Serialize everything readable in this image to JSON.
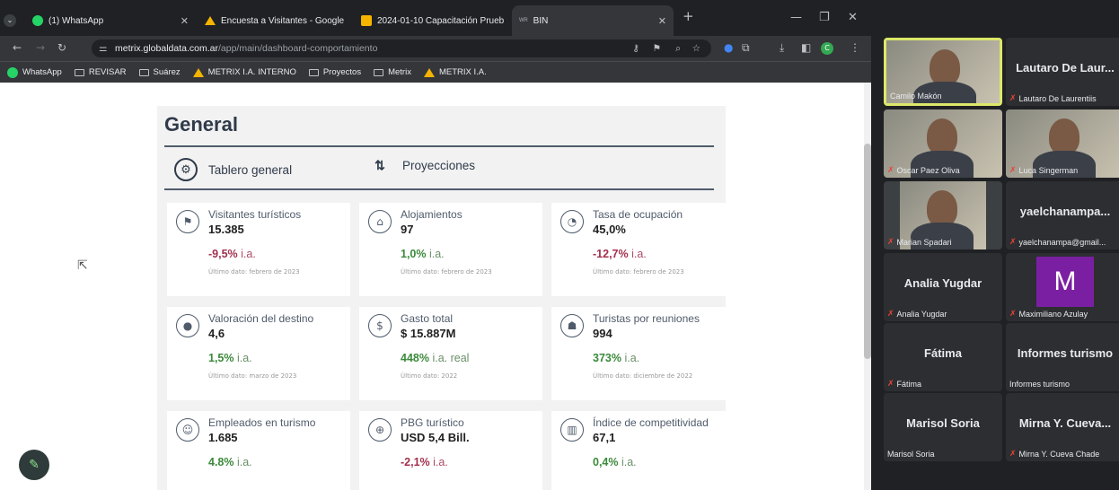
{
  "browser": {
    "tabs": [
      {
        "label": "(1) WhatsApp",
        "favicon": "whatsapp-icon",
        "color": "#25d366"
      },
      {
        "label": "Encuesta a Visitantes - Google",
        "favicon": "drive-icon",
        "color": "#f4b400"
      },
      {
        "label": "2024-01-10 Capacitación Prueb",
        "favicon": "slides-icon",
        "color": "#f4b400"
      },
      {
        "label": "BIN",
        "favicon": "bin-icon",
        "color": "#9aa0a6"
      }
    ],
    "new_tab": "+",
    "address": {
      "domain": "metrix.globaldata.com.ar",
      "path": "/app/main/dashboard-comportamiento"
    },
    "bookmarks": [
      {
        "label": "WhatsApp",
        "icon": "whatsapp-icon"
      },
      {
        "label": "REVISAR",
        "icon": "folder-icon"
      },
      {
        "label": "Suárez",
        "icon": "folder-icon"
      },
      {
        "label": "METRIX I.A. INTERNO",
        "icon": "metrix-icon"
      },
      {
        "label": "Proyectos",
        "icon": "folder-icon"
      },
      {
        "label": "Metrix",
        "icon": "folder-icon"
      },
      {
        "label": "METRIX I.A.",
        "icon": "metrix-icon"
      }
    ],
    "profile_initial": "C"
  },
  "dashboard": {
    "title": "General",
    "tabs": [
      {
        "label": "Tablero general",
        "icon": "gauge-icon"
      },
      {
        "label": "Proyecciones",
        "icon": "sort-icon"
      }
    ],
    "cards": [
      {
        "title": "Visitantes turísticos",
        "value": "15.385",
        "change": "-9,5%",
        "unit": "i.a.",
        "trend": "neg",
        "note": "Último dato: febrero de 2023",
        "icon": "flag-icon"
      },
      {
        "title": "Alojamientos",
        "value": "97",
        "change": "1,0%",
        "unit": "i.a.",
        "trend": "pos",
        "note": "Último dato: febrero de 2023",
        "icon": "home-icon"
      },
      {
        "title": "Tasa de ocupación",
        "value": "45,0%",
        "change": "-12,7%",
        "unit": "i.a.",
        "trend": "neg",
        "note": "Último dato: febrero de 2023",
        "icon": "pie-icon"
      },
      {
        "title": "Valoración del destino",
        "value": "4,6",
        "change": "1,5%",
        "unit": "i.a.",
        "trend": "pos",
        "note": "Último dato: marzo de 2023",
        "icon": "location-icon"
      },
      {
        "title": "Gasto total",
        "value": "$ 15.887M",
        "change": "448%",
        "unit": "i.a. real",
        "trend": "pos",
        "note": "Último dato: 2022",
        "icon": "dollar-icon"
      },
      {
        "title": "Turistas por reuniones",
        "value": "994",
        "change": "373%",
        "unit": "i.a.",
        "trend": "pos",
        "note": "Último dato: diciembre de 2022",
        "icon": "meeting-icon"
      },
      {
        "title": "Empleados en turismo",
        "value": "1.685",
        "change": "4.8%",
        "unit": "i.a.",
        "trend": "pos",
        "note": "",
        "icon": "employee-icon"
      },
      {
        "title": "PBG turístico",
        "value": "USD 5,4 Bill.",
        "change": "-2,1%",
        "unit": "i.a.",
        "trend": "neg",
        "note": "",
        "icon": "globe-icon"
      },
      {
        "title": "Índice de competitividad",
        "value": "67,1",
        "change": "0,4%",
        "unit": "i.a.",
        "trend": "pos",
        "note": "",
        "icon": "bar-chart-icon"
      }
    ]
  },
  "meet": {
    "participants": [
      {
        "name": "Camilo Makón",
        "big": "",
        "muted": false,
        "video": true
      },
      {
        "name": "Lautaro De Laurentiis",
        "big": "Lautaro De Laur...",
        "muted": true,
        "video": false
      },
      {
        "name": "Oscar Paez Oliva",
        "big": "",
        "muted": true,
        "video": true
      },
      {
        "name": "Luca Singerman",
        "big": "",
        "muted": true,
        "video": true
      },
      {
        "name": "Marian Spadari",
        "big": "",
        "muted": true,
        "video": true
      },
      {
        "name": "yaelchanampa@gmail...",
        "big": "yaelchanampa...",
        "muted": true,
        "video": false
      },
      {
        "name": "Analia Yugdar",
        "big": "Analia Yugdar",
        "muted": true,
        "video": false
      },
      {
        "name": "Maximiliano Azulay",
        "big": "M",
        "muted": true,
        "video": false
      },
      {
        "name": "Fátima",
        "big": "Fátima",
        "muted": true,
        "video": false
      },
      {
        "name": "Informes turismo",
        "big": "Informes turismo",
        "muted": false,
        "video": false
      },
      {
        "name": "Marisol Soria",
        "big": "Marisol Soria",
        "muted": false,
        "video": false
      },
      {
        "name": "Mirna Y. Cueva Chade",
        "big": "Mirna Y. Cueva...",
        "muted": true,
        "video": false
      }
    ]
  }
}
